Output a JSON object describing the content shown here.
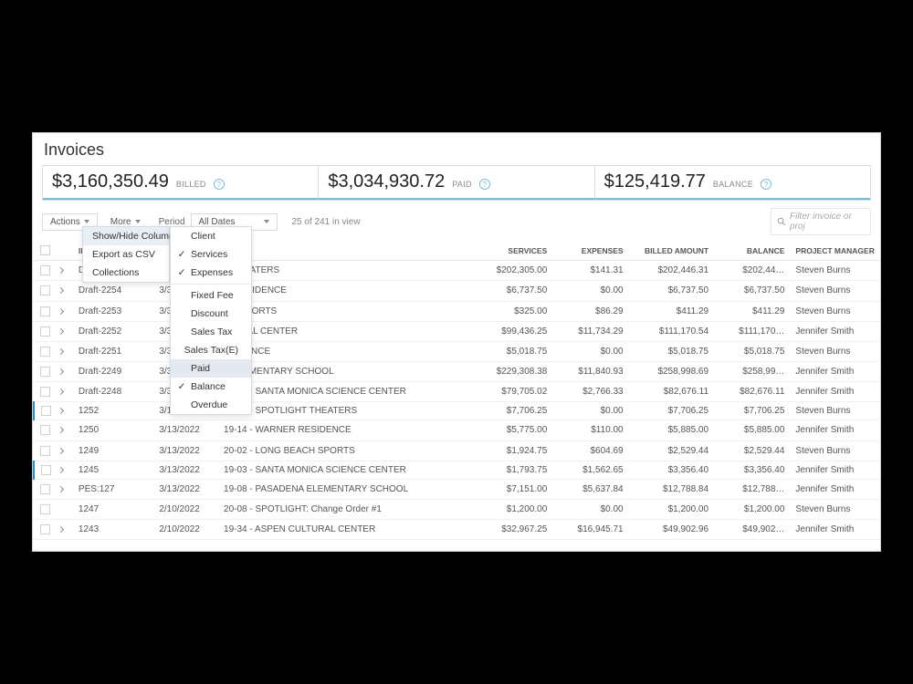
{
  "page_title": "Invoices",
  "summary": {
    "billed": {
      "amount": "$3,160,350.49",
      "label": "BILLED"
    },
    "paid": {
      "amount": "$3,034,930.72",
      "label": "PAID"
    },
    "balance": {
      "amount": "$125,419.77",
      "label": "BALANCE"
    }
  },
  "toolbar": {
    "actions": "Actions",
    "more": "More",
    "period_label": "Period",
    "period_value": "All Dates",
    "count": "25 of 241 in view",
    "search_placeholder": "Filter invoice or proj"
  },
  "more_menu": {
    "items": [
      {
        "label": "Show/Hide Columns",
        "has_sub": true
      },
      {
        "label": "Export as CSV"
      },
      {
        "label": "Collections"
      }
    ]
  },
  "columns_submenu": [
    {
      "label": "Client",
      "checked": false
    },
    {
      "label": "Services",
      "checked": true
    },
    {
      "label": "Expenses",
      "checked": true
    },
    {
      "label": "Fixed Fee",
      "checked": false
    },
    {
      "label": "Discount",
      "checked": false
    },
    {
      "label": "Sales Tax",
      "checked": false
    },
    {
      "label": "Sales Tax(E)",
      "checked": false
    },
    {
      "label": "Paid",
      "checked": false,
      "highlight": true
    },
    {
      "label": "Balance",
      "checked": true
    },
    {
      "label": "Overdue",
      "checked": false
    }
  ],
  "columns": {
    "invoice": "INVOICE",
    "date": "",
    "project": "",
    "services": "SERVICES",
    "expenses": "EXPENSES",
    "billed": "BILLED AMOUNT",
    "balance": "BALANCE",
    "pm": "PROJECT MANAGER"
  },
  "rows": [
    {
      "exp": true,
      "invoice": "D…",
      "date": "",
      "project": "T THEATERS",
      "services": "$202,305.00",
      "expenses": "$141.31",
      "billed": "$202,446.31",
      "balance": "$202,44…",
      "pm": "Steven Burns"
    },
    {
      "exp": true,
      "invoice": "Draft-2254",
      "date": "3/31/…",
      "project": "O RESIDENCE",
      "services": "$6,737.50",
      "expenses": "$0.00",
      "billed": "$6,737.50",
      "balance": "$6,737.50",
      "pm": "Steven Burns"
    },
    {
      "exp": true,
      "invoice": "Draft-2253",
      "date": "3/31/…",
      "project": "CH SPORTS",
      "services": "$325.00",
      "expenses": "$86.29",
      "billed": "$411.29",
      "balance": "$411.29",
      "pm": "Steven Burns"
    },
    {
      "exp": true,
      "invoice": "Draft-2252",
      "date": "3/31/…",
      "project": "LTURAL CENTER",
      "services": "$99,436.25",
      "expenses": "$11,734.29",
      "billed": "$111,170.54",
      "balance": "$111,170…",
      "pm": "Jennifer Smith"
    },
    {
      "exp": true,
      "invoice": "Draft-2251",
      "date": "3/31/…",
      "project": "ESIDENCE",
      "services": "$5,018.75",
      "expenses": "$0.00",
      "billed": "$5,018.75",
      "balance": "$5,018.75",
      "pm": "Steven Burns"
    },
    {
      "exp": true,
      "invoice": "Draft-2249",
      "date": "3/31/…",
      "project": "A ELEMENTARY SCHOOL",
      "services": "$229,308.38",
      "expenses": "$11,840.93",
      "billed": "$258,998.69",
      "balance": "$258,99…",
      "pm": "Jennifer Smith"
    },
    {
      "exp": true,
      "invoice": "Draft-2248",
      "date": "3/31/2023",
      "project": "19-03 - SANTA MONICA SCIENCE CENTER",
      "services": "$79,705.02",
      "expenses": "$2,766.33",
      "billed": "$82,676.11",
      "balance": "$82,676.11",
      "pm": "Jennifer Smith"
    },
    {
      "exp": true,
      "invoice": "1252",
      "date": "3/13/2022",
      "project": "20-08 - SPOTLIGHT THEATERS",
      "services": "$7,706.25",
      "expenses": "$0.00",
      "billed": "$7,706.25",
      "balance": "$7,706.25",
      "pm": "Steven Burns",
      "hl": true
    },
    {
      "exp": true,
      "invoice": "1250",
      "date": "3/13/2022",
      "project": "19-14 - WARNER RESIDENCE",
      "services": "$5,775.00",
      "expenses": "$110.00",
      "billed": "$5,885.00",
      "balance": "$5,885.00",
      "pm": "Jennifer Smith"
    },
    {
      "exp": true,
      "invoice": "1249",
      "date": "3/13/2022",
      "project": "20-02 - LONG BEACH SPORTS",
      "services": "$1,924.75",
      "expenses": "$604.69",
      "billed": "$2,529.44",
      "balance": "$2,529.44",
      "pm": "Steven Burns"
    },
    {
      "exp": true,
      "invoice": "1245",
      "date": "3/13/2022",
      "project": "19-03 - SANTA MONICA SCIENCE CENTER",
      "services": "$1,793.75",
      "expenses": "$1,562.65",
      "billed": "$3,356.40",
      "balance": "$3,356.40",
      "pm": "Jennifer Smith",
      "hl": true
    },
    {
      "exp": true,
      "invoice": "PES:127",
      "date": "3/13/2022",
      "project": "19-08 - PASADENA ELEMENTARY SCHOOL",
      "services": "$7,151.00",
      "expenses": "$5,637.84",
      "billed": "$12,788.84",
      "balance": "$12,788…",
      "pm": "Jennifer Smith"
    },
    {
      "exp": false,
      "invoice": "1247",
      "date": "2/10/2022",
      "project": "20-08 - SPOTLIGHT: Change Order #1",
      "services": "$1,200.00",
      "expenses": "$0.00",
      "billed": "$1,200.00",
      "balance": "$1,200.00",
      "pm": "Steven Burns"
    },
    {
      "exp": true,
      "invoice": "1243",
      "date": "2/10/2022",
      "project": "19-34 - ASPEN CULTURAL CENTER",
      "services": "$32,967.25",
      "expenses": "$16,945.71",
      "billed": "$49,902.96",
      "balance": "$49,902…",
      "pm": "Jennifer Smith"
    }
  ]
}
